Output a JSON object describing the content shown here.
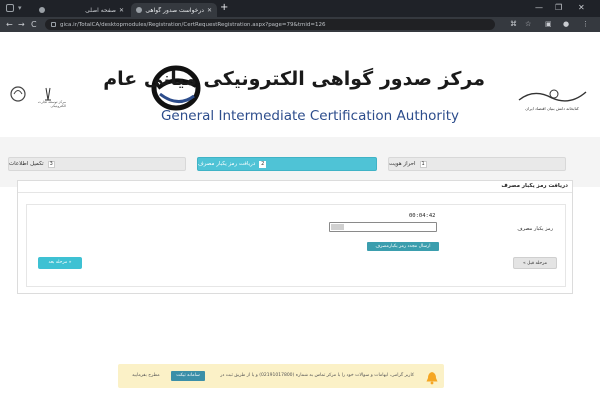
{
  "browser": {
    "tabs": [
      {
        "title": "صفحه اصلی",
        "active": false
      },
      {
        "title": "درخواست صدور گواهی",
        "active": true
      }
    ],
    "new_tab": "+",
    "url": "gica.ir/TotalCA/desktopmodules/Registration/CertRequestRegistration.aspx?page=79&tmid=126",
    "back": "←",
    "forward": "→",
    "reload": "C",
    "minimize": "—",
    "maximize": "❐",
    "close": "✕"
  },
  "header": {
    "title_fa": "مرکز صدور گواهی الکترونیکی میانی عام",
    "title_en": "General Intermediate Certification Authority",
    "left_emblem_text": "مرکز توسعه تجارت الکترونیکی",
    "right_emblem_text": "کتابخانه دانش بنیان اقتصاد ایران"
  },
  "steps": [
    {
      "num": "1",
      "label": "احراز هویت"
    },
    {
      "num": "2",
      "label": "دریافت رمز یکبار مصرف"
    },
    {
      "num": "3",
      "label": "تکمیل اطلاعات"
    }
  ],
  "form": {
    "card_title": "دریافت رمز یکبار مصرف",
    "otp_label": "رمز یکبار مصرف",
    "timer": "00:04:42",
    "otp_value": "",
    "otp_fill_fraction": 0.12,
    "resend_label": "ارسال مجدد رمز یکبارمصرف",
    "next_label": "« مرحله بعد",
    "prev_label": "مرحله قبل »"
  },
  "notice": {
    "text": "کاربر گرامی، ابهامات و سوالات خود را با مرکز تماس به شماره (02191017800) و یا از طریق ثبت در",
    "button": "سامانه تیکت",
    "link": "مطرح بفرمایید"
  },
  "colors": {
    "active_step": "#4fc3d6",
    "primary_button": "#3b9eae",
    "notice_bg": "#fbf1c7",
    "title_en": "#2d4d8c"
  }
}
